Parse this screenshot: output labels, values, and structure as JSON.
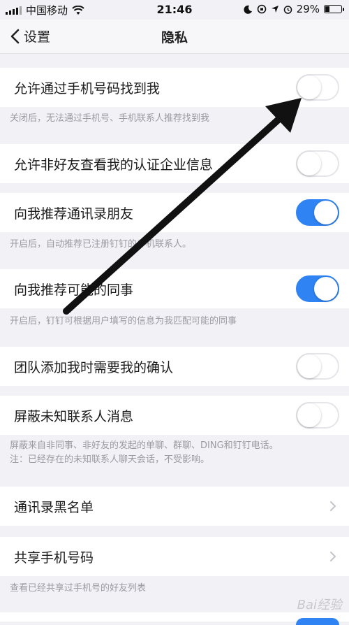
{
  "status_bar": {
    "carrier": "中国移动",
    "time": "21:46",
    "battery": "29%",
    "battery_level": 0.29
  },
  "nav": {
    "back_label": "设置",
    "title": "隐私"
  },
  "settings": [
    {
      "label": "允许通过手机号码找到我",
      "toggle": "off",
      "note": "关闭后，无法通过手机号、手机联系人推荐找到我"
    },
    {
      "label": "允许非好友查看我的认证企业信息",
      "toggle": "off",
      "note": ""
    },
    {
      "label": "向我推荐通讯录朋友",
      "toggle": "on",
      "note": "开启后，自动推荐已注册钉钉的手机联系人。"
    },
    {
      "label": "向我推荐可能的同事",
      "toggle": "on",
      "note": "开启后，钉钉可根据用户填写的信息为我匹配可能的同事"
    },
    {
      "label": "团队添加我时需要我的确认",
      "toggle": "off",
      "note": ""
    },
    {
      "label": "屏蔽未知联系人消息",
      "toggle": "off",
      "note_lines": [
        "屏蔽来自非同事、非好友的发起的单聊、群聊、DING和钉钉电话。",
        "注：已经存在的未知联系人聊天会话，不受影响。"
      ]
    }
  ],
  "blacklist": {
    "label": "通讯录黑名单"
  },
  "shared_phone": {
    "label": "共享手机号码",
    "note": "查看已经共享过手机号的好友列表"
  },
  "watermark": "Bai经验"
}
